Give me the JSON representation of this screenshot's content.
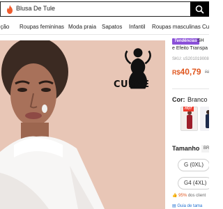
{
  "search": {
    "value": "Blusa De Tule",
    "button_icon": "search-icon"
  },
  "nav": {
    "items": [
      "ução",
      "Roupas femininas",
      "Moda praia",
      "Sapatos",
      "Infantil",
      "Roupas masculinas",
      "Cu"
    ]
  },
  "product_image": {
    "badge_text": "CURVE",
    "badge_icon": "curve-silhouette-icon"
  },
  "product": {
    "tag": "Tendências",
    "title_line1": "SH",
    "title_line2": "e Efeito Transpa",
    "sku": "SKU: sS201019008",
    "currency": "R$",
    "price": "40,79",
    "old_price": "R$",
    "color_label": "Cor:",
    "color_value": "Branco",
    "hot_badge": "HOT",
    "size_label": "Tamanho",
    "size_chip": "BR",
    "sizes": [
      "G (0XL)",
      "G4 (4XL)"
    ],
    "stat_percent": "95%",
    "stat_text": "dos client",
    "guide_text": "Guia de tama"
  },
  "colors": {
    "brand": "#000000",
    "price": "#e0561e",
    "tag": "#8a4fd8",
    "hot": "#ef3b2d"
  }
}
